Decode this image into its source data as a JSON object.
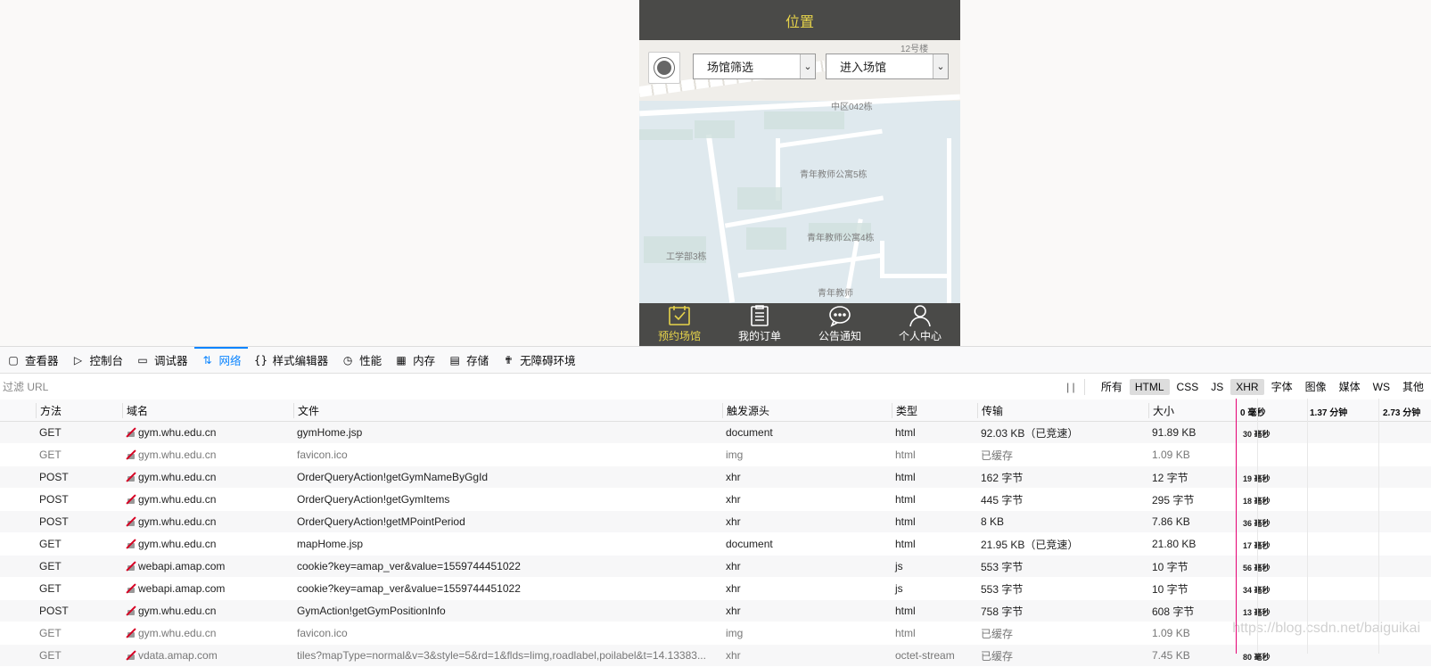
{
  "phone": {
    "title": "位置",
    "venue_filter": "场馆筛选",
    "enter_venue": "进入场馆",
    "map_labels": [
      "12号楼",
      "中区042栋",
      "青年教师公寓5栋",
      "青年教师公寓4栋",
      "工学部3栋",
      "青年教师"
    ],
    "tabs": [
      "预约场馆",
      "我的订单",
      "公告通知",
      "个人中心"
    ]
  },
  "devtools": {
    "tabs": [
      {
        "icon": "inspector-icon",
        "label": "查看器"
      },
      {
        "icon": "console-icon",
        "label": "控制台"
      },
      {
        "icon": "debugger-icon",
        "label": "调试器"
      },
      {
        "icon": "network-icon",
        "label": "网络"
      },
      {
        "icon": "style-editor-icon",
        "label": "样式编辑器"
      },
      {
        "icon": "performance-icon",
        "label": "性能"
      },
      {
        "icon": "memory-icon",
        "label": "内存"
      },
      {
        "icon": "storage-icon",
        "label": "存储"
      },
      {
        "icon": "accessibility-icon",
        "label": "无障碍环境"
      }
    ],
    "filter_placeholder": "过滤 URL",
    "pause_label": "| |",
    "type_filters": [
      "所有",
      "HTML",
      "CSS",
      "JS",
      "XHR",
      "字体",
      "图像",
      "媒体",
      "WS",
      "其他"
    ],
    "columns": [
      "方法",
      "域名",
      "文件",
      "触发源头",
      "类型",
      "传输",
      "大小"
    ],
    "timeline_marks": [
      "0 毫秒",
      "1.37 分钟",
      "2.73 分钟"
    ],
    "rows": [
      {
        "method": "GET",
        "domain": "gym.whu.edu.cn",
        "file": "gymHome.jsp",
        "cause": "document",
        "type": "html",
        "transferred": "92.03 KB（已竞速）",
        "size": "91.89 KB",
        "time": "30 毫秒"
      },
      {
        "method": "GET",
        "domain": "gym.whu.edu.cn",
        "file": "favicon.ico",
        "cause": "img",
        "type": "html",
        "transferred": "已缓存",
        "size": "1.09 KB",
        "time": ""
      },
      {
        "method": "POST",
        "domain": "gym.whu.edu.cn",
        "file": "OrderQueryAction!getGymNameByGgId",
        "cause": "xhr",
        "type": "html",
        "transferred": "162 字节",
        "size": "12 字节",
        "time": "19 毫秒"
      },
      {
        "method": "POST",
        "domain": "gym.whu.edu.cn",
        "file": "OrderQueryAction!getGymItems",
        "cause": "xhr",
        "type": "html",
        "transferred": "445 字节",
        "size": "295 字节",
        "time": "18 毫秒"
      },
      {
        "method": "POST",
        "domain": "gym.whu.edu.cn",
        "file": "OrderQueryAction!getMPointPeriod",
        "cause": "xhr",
        "type": "html",
        "transferred": "8 KB",
        "size": "7.86 KB",
        "time": "36 毫秒"
      },
      {
        "method": "GET",
        "domain": "gym.whu.edu.cn",
        "file": "mapHome.jsp",
        "cause": "document",
        "type": "html",
        "transferred": "21.95 KB（已竞速）",
        "size": "21.80 KB",
        "time": "17 毫秒"
      },
      {
        "method": "GET",
        "domain": "webapi.amap.com",
        "file": "cookie?key=amap_ver&value=1559744451022",
        "cause": "xhr",
        "type": "js",
        "transferred": "553 字节",
        "size": "10 字节",
        "time": "56 毫秒"
      },
      {
        "method": "GET",
        "domain": "webapi.amap.com",
        "file": "cookie?key=amap_ver&value=1559744451022",
        "cause": "xhr",
        "type": "js",
        "transferred": "553 字节",
        "size": "10 字节",
        "time": "34 毫秒"
      },
      {
        "method": "POST",
        "domain": "gym.whu.edu.cn",
        "file": "GymAction!getGymPositionInfo",
        "cause": "xhr",
        "type": "html",
        "transferred": "758 字节",
        "size": "608 字节",
        "time": "13 毫秒"
      },
      {
        "method": "GET",
        "domain": "gym.whu.edu.cn",
        "file": "favicon.ico",
        "cause": "img",
        "type": "html",
        "transferred": "已缓存",
        "size": "1.09 KB",
        "time": ""
      },
      {
        "method": "GET",
        "domain": "vdata.amap.com",
        "file": "tiles?mapType=normal&v=3&style=5&rd=1&flds=limg,roadlabel,poilabel&t=14.13383...",
        "cause": "xhr",
        "type": "octet-stream",
        "transferred": "已缓存",
        "size": "7.45 KB",
        "time": "80 毫秒"
      }
    ],
    "watermark": "https://blog.csdn.net/baiguikai"
  }
}
